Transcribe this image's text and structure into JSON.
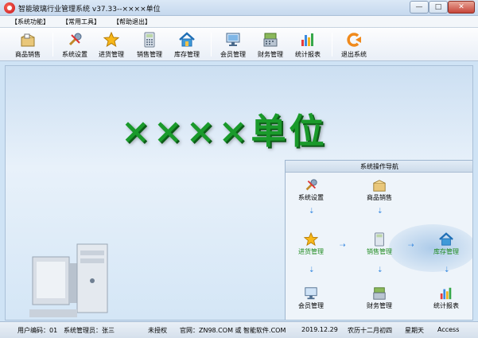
{
  "window": {
    "title": "智能玻璃行业管理系统 v37.33--××××单位"
  },
  "menu": [
    {
      "label": "【系统功能】"
    },
    {
      "label": "【常用工具】"
    },
    {
      "label": "【帮助退出】"
    }
  ],
  "toolbar": [
    {
      "label": "商品销售",
      "icon": "package-icon"
    },
    {
      "label": "系统设置",
      "icon": "wrench-icon"
    },
    {
      "label": "进货管理",
      "icon": "star-icon"
    },
    {
      "label": "销售管理",
      "icon": "calculator-icon"
    },
    {
      "label": "库存管理",
      "icon": "house-icon"
    },
    {
      "label": "会员管理",
      "icon": "monitor-icon"
    },
    {
      "label": "财务管理",
      "icon": "register-icon"
    },
    {
      "label": "统计报表",
      "icon": "bar-chart-icon"
    },
    {
      "label": "退出系统",
      "icon": "exit-icon"
    }
  ],
  "main": {
    "unit_name": "××××单位"
  },
  "nav": {
    "title": "系统操作导航",
    "nodes": [
      {
        "label": "系统设置",
        "icon": "wrench-icon"
      },
      {
        "label": "商品销售",
        "icon": "package-icon"
      },
      {
        "label": "进货管理",
        "icon": "star-icon"
      },
      {
        "label": "销售管理",
        "icon": "calculator-icon"
      },
      {
        "label": "库存管理",
        "icon": "house-icon"
      },
      {
        "label": "会员管理",
        "icon": "monitor-icon"
      },
      {
        "label": "财务管理",
        "icon": "register-icon"
      },
      {
        "label": "统计报表",
        "icon": "bar-chart-icon"
      }
    ]
  },
  "status": {
    "user_code": "用户编码：01",
    "admin": "系统管理员：张三",
    "license": "未授权",
    "website": "官网：ZN98.COM 或 智能软件.COM",
    "date": "2019.12.29",
    "lunar": "农历十二月初四",
    "weekday": "星期天",
    "db": "Access"
  },
  "colors": {
    "title_green": "#1a9a2b",
    "accent_blue": "#3c8be0"
  }
}
